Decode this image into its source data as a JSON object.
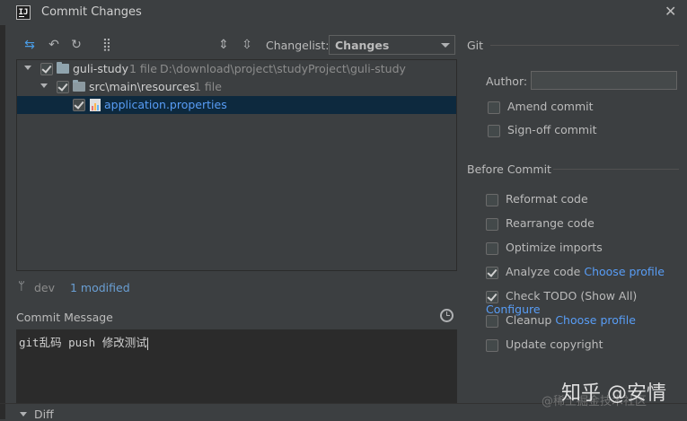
{
  "window": {
    "title": "Commit Changes",
    "app_icon_text": "IJ"
  },
  "toolbar": {
    "icons": [
      "refresh-diff-icon",
      "rollback-icon",
      "refresh-icon",
      "group-by-icon",
      "expand-all-icon",
      "collapse-all-icon"
    ],
    "changelist_label": "Changelist:",
    "changelist_value": "Changes"
  },
  "tree": {
    "rows": [
      {
        "name": "guli-study",
        "meta": "1 file",
        "path": "D:\\download\\project\\studyProject\\guli-study",
        "checked": true
      },
      {
        "name": "src\\main\\resources",
        "meta": "1 file",
        "checked": true
      },
      {
        "name": "application.properties",
        "checked": true,
        "selected": true
      }
    ]
  },
  "status": {
    "branch": "dev",
    "modified": "1 modified"
  },
  "commit_message": {
    "label": "Commit Message",
    "text": "git乱码 push 修改测试"
  },
  "diff": {
    "label": "Diff"
  },
  "git": {
    "section_label": "Git",
    "author_label": "Author:",
    "author_value": "",
    "options": [
      {
        "label": "Amend commit",
        "checked": false
      },
      {
        "label": "Sign-off commit",
        "checked": false
      }
    ]
  },
  "before_commit": {
    "section_label": "Before Commit",
    "options": [
      {
        "label": "Reformat code",
        "checked": false,
        "link": ""
      },
      {
        "label": "Rearrange code",
        "checked": false,
        "link": ""
      },
      {
        "label": "Optimize imports",
        "checked": false,
        "link": ""
      },
      {
        "label": "Analyze code",
        "checked": true,
        "link": "Choose profile"
      },
      {
        "label": "Check TODO (Show All)",
        "checked": true,
        "link": "Configure"
      },
      {
        "label": "Cleanup",
        "checked": false,
        "link": "Choose profile"
      },
      {
        "label": "Update copyright",
        "checked": false,
        "link": ""
      }
    ]
  },
  "watermark": {
    "main": "知乎 @安情",
    "sub": "@稀土掘金技术社区"
  },
  "colors": {
    "background": "#3c3f41",
    "editor_bg": "#2b2b2b",
    "selection": "#0d293e",
    "link": "#589df6",
    "text": "#bbbbbb"
  }
}
